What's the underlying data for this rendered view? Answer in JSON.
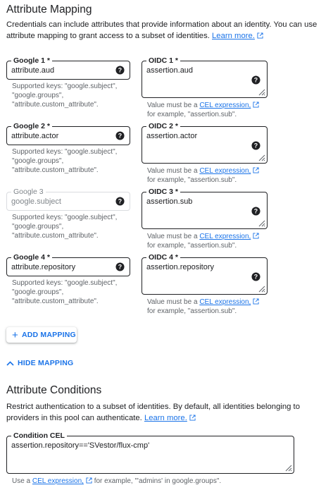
{
  "mapping": {
    "title": "Attribute Mapping",
    "description": "Credentials can include attributes that provide information about an identity. You can use attribute mapping to grant access to a subset of identities.",
    "learn_more": "Learn more.",
    "rows": [
      {
        "google_label": "Google 1 *",
        "google_value": "attribute.aud",
        "google_disabled": false,
        "google_hint": "Supported keys: \"google.subject\", \"google.groups\", \"attribute.custom_attribute\".",
        "oidc_label": "OIDC 1 *",
        "oidc_value": "assertion.aud"
      },
      {
        "google_label": "Google 2 *",
        "google_value": "attribute.actor",
        "google_disabled": false,
        "google_hint": "Supported keys: \"google.subject\", \"google.groups\", \"attribute.custom_attribute\".",
        "oidc_label": "OIDC 2 *",
        "oidc_value": "assertion.actor"
      },
      {
        "google_label": "Google 3",
        "google_value": "google.subject",
        "google_disabled": true,
        "google_hint": "Supported keys: \"google.subject\", \"google.groups\", \"attribute.custom_attribute\".",
        "oidc_label": "OIDC 3 *",
        "oidc_value": "assertion.sub"
      },
      {
        "google_label": "Google 4 *",
        "google_value": "attribute.repository",
        "google_disabled": false,
        "google_hint": "Supported keys: \"google.subject\", \"google.groups\", \"attribute.custom_attribute\".",
        "oidc_label": "OIDC 4 *",
        "oidc_value": "assertion.repository"
      }
    ],
    "oidc_hint_prefix": "Value must be a",
    "oidc_hint_link": "CEL expression,",
    "oidc_hint_suffix": "for example, \"assertion.sub\".",
    "add_mapping": "ADD MAPPING",
    "hide_mapping": "HIDE MAPPING"
  },
  "conditions": {
    "title": "Attribute Conditions",
    "description": "Restrict authentication to a subset of identities. By default, all identities belonging to providers in this pool can authenticate.",
    "learn_more": "Learn more.",
    "field_label": "Condition CEL",
    "field_value": "assertion.repository=='SVestor/flux-cmp'",
    "hint_prefix": "Use a",
    "hint_link": "CEL expression,",
    "hint_suffix": "for example, \"'admins' in google.groups\"."
  },
  "icons": {
    "help": "help-circle-icon",
    "external": "open-in-new-icon",
    "add": "plus-icon",
    "collapse": "chevron-up-icon",
    "resize": "resize-handle-icon"
  },
  "colors": {
    "link": "#1a73e8",
    "text": "#202124",
    "hint": "#5f6368",
    "disabled": "#80868b"
  }
}
